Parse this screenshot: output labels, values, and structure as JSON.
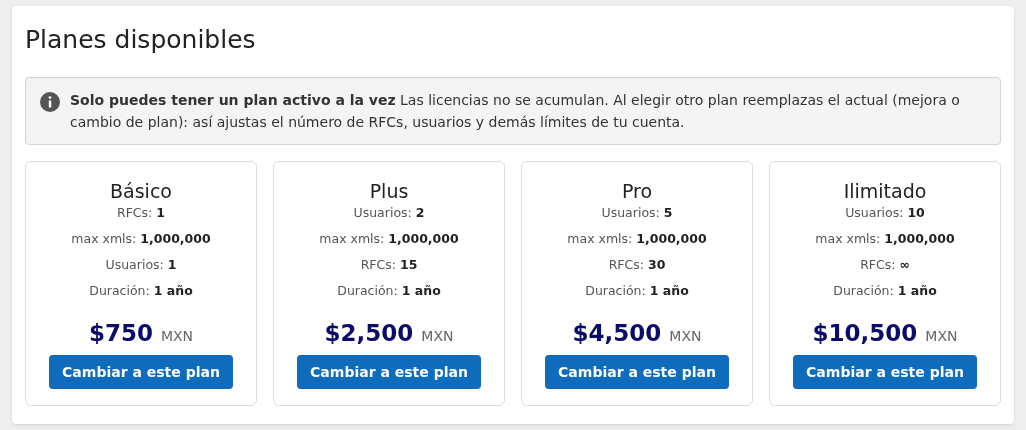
{
  "title": "Planes disponibles",
  "notice": {
    "text": "**Solo puedes tener un plan activo a la vez** Las licencias no se acumulan. Al elegir otro plan reemplazas el actual (mejora o cambio de plan): así ajustas el número de RFCs, usuarios y demás límites de tu cuenta."
  },
  "plans": [
    {
      "name": "Básico",
      "specs": [
        {
          "label": "RFCs:",
          "value": "1"
        },
        {
          "label": "max xmls:",
          "value": "1,000,000"
        },
        {
          "label": "Usuarios:",
          "value": "1"
        },
        {
          "label": "Duración:",
          "value": "1 año"
        }
      ],
      "price": "$750",
      "currency": "MXN",
      "button": "Cambiar a este plan"
    },
    {
      "name": "Plus",
      "specs": [
        {
          "label": "Usuarios:",
          "value": "2"
        },
        {
          "label": "max xmls:",
          "value": "1,000,000"
        },
        {
          "label": "RFCs:",
          "value": "15"
        },
        {
          "label": "Duración:",
          "value": "1 año"
        }
      ],
      "price": "$2,500",
      "currency": "MXN",
      "button": "Cambiar a este plan"
    },
    {
      "name": "Pro",
      "specs": [
        {
          "label": "Usuarios:",
          "value": "5"
        },
        {
          "label": "max xmls:",
          "value": "1,000,000"
        },
        {
          "label": "RFCs:",
          "value": "30"
        },
        {
          "label": "Duración:",
          "value": "1 año"
        }
      ],
      "price": "$4,500",
      "currency": "MXN",
      "button": "Cambiar a este plan"
    },
    {
      "name": "Ilimitado",
      "specs": [
        {
          "label": "Usuarios:",
          "value": "10"
        },
        {
          "label": "max xmls:",
          "value": "1,000,000"
        },
        {
          "label": "RFCs:",
          "value": "∞"
        },
        {
          "label": "Duración:",
          "value": "1 año"
        }
      ],
      "price": "$10,500",
      "currency": "MXN",
      "button": "Cambiar a este plan"
    }
  ]
}
